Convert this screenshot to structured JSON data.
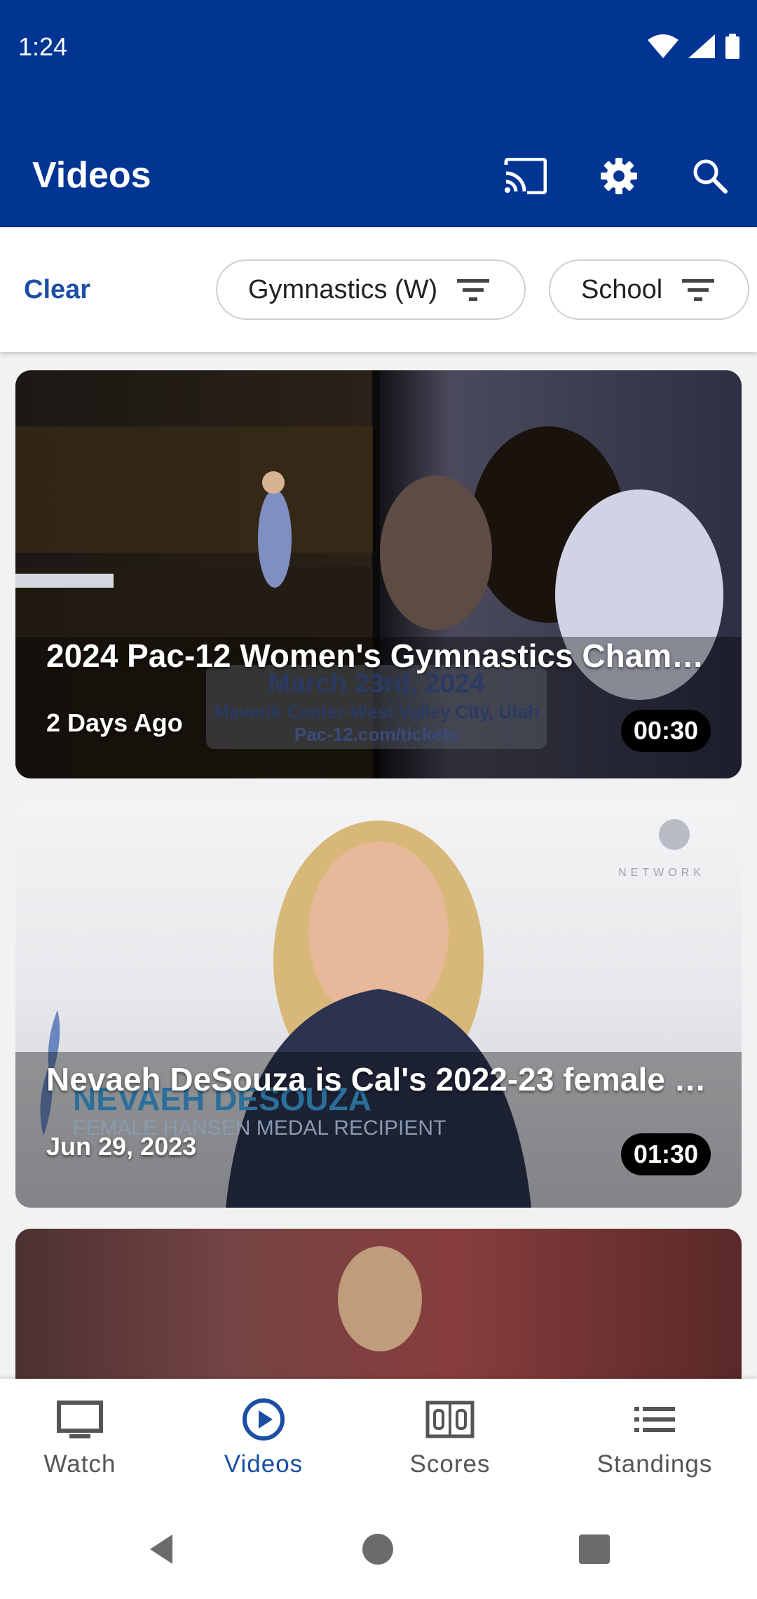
{
  "status_bar": {
    "time": "1:24",
    "icons": [
      "wifi-icon",
      "signal-icon",
      "battery-icon"
    ]
  },
  "app_bar": {
    "title": "Videos",
    "icons": [
      "cast-icon",
      "gear-icon",
      "search-icon"
    ]
  },
  "filters": {
    "clear_label": "Clear",
    "chips": [
      {
        "label": "Gymnastics (W)",
        "icon": "filter-icon"
      },
      {
        "label": "School",
        "icon": "filter-icon"
      }
    ]
  },
  "videos": [
    {
      "title": "2024 Pac-12 Women's Gymnastics Cham…",
      "date": "2 Days Ago",
      "duration": "00:30",
      "overlay": {
        "line1": "March 23rd, 2024",
        "line2": "Maverik Center-West Valley City, Utah",
        "line3": "Pac-12.com/tickets"
      }
    },
    {
      "title": "Nevaeh DeSouza is Cal's 2022-23 female …",
      "date": "Jun 29, 2023",
      "duration": "01:30",
      "overlay": {
        "line1": "NEVAEH DESOUZA",
        "line2": "FEMALE HANSEN MEDAL RECIPIENT",
        "watermark": "NETWORK"
      }
    },
    {
      "title": "",
      "date": "",
      "duration": ""
    }
  ],
  "bottom_nav": [
    {
      "label": "Watch",
      "icon": "tv-icon",
      "active": false
    },
    {
      "label": "Videos",
      "icon": "play-circle-icon",
      "active": true
    },
    {
      "label": "Scores",
      "icon": "scoreboard-icon",
      "active": false
    },
    {
      "label": "Standings",
      "icon": "list-icon",
      "active": false
    }
  ],
  "system_nav": [
    "back-icon",
    "home-icon",
    "recents-icon"
  ],
  "colors": {
    "brand": "#003594",
    "active": "#1c4fa3",
    "inactive": "#555555"
  }
}
